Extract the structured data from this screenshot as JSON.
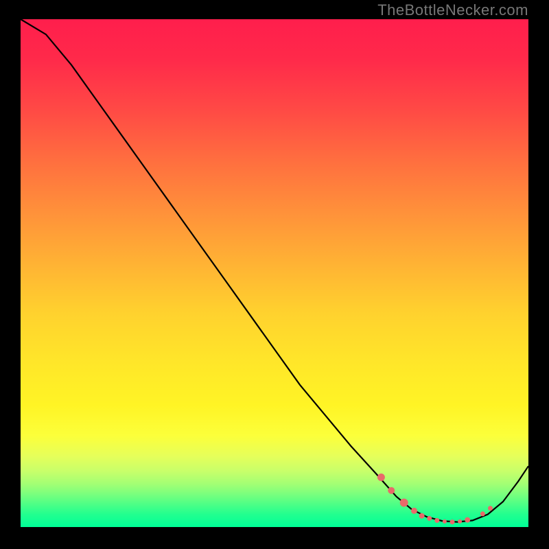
{
  "watermark": "TheBottleNecker.com",
  "chart_data": {
    "type": "line",
    "title": "",
    "xlabel": "",
    "ylabel": "",
    "xlim": [
      0,
      100
    ],
    "ylim": [
      0,
      100
    ],
    "grid": false,
    "legend": false,
    "gradient_stops": [
      {
        "pos": 0,
        "color": "#ff1e4c"
      },
      {
        "pos": 50,
        "color": "#ffd22e"
      },
      {
        "pos": 82,
        "color": "#fcff3a"
      },
      {
        "pos": 100,
        "color": "#00ff97"
      }
    ],
    "series": [
      {
        "name": "curve",
        "color": "#000000",
        "x": [
          0,
          5,
          10,
          15,
          20,
          25,
          30,
          35,
          40,
          45,
          50,
          55,
          60,
          65,
          70,
          74,
          77,
          80,
          83,
          86,
          89,
          92,
          95,
          98,
          100
        ],
        "y": [
          100,
          97,
          91,
          84,
          77,
          70,
          63,
          56,
          49,
          42,
          35,
          28,
          22,
          16,
          10.5,
          6,
          3.5,
          2,
          1.2,
          1,
          1.3,
          2.5,
          5,
          9,
          12
        ]
      }
    ],
    "markers": {
      "color": "#e86a6a",
      "radius_range": [
        2.5,
        6
      ],
      "points": [
        {
          "x": 71,
          "y": 9.8,
          "r": 5.5
        },
        {
          "x": 73,
          "y": 7.2,
          "r": 5
        },
        {
          "x": 75.5,
          "y": 4.8,
          "r": 6
        },
        {
          "x": 77.5,
          "y": 3.2,
          "r": 4.5
        },
        {
          "x": 79,
          "y": 2.2,
          "r": 4
        },
        {
          "x": 80.5,
          "y": 1.7,
          "r": 3.5
        },
        {
          "x": 82,
          "y": 1.3,
          "r": 3.5
        },
        {
          "x": 83.5,
          "y": 1.1,
          "r": 3
        },
        {
          "x": 85,
          "y": 1.0,
          "r": 3.5
        },
        {
          "x": 86.5,
          "y": 1.1,
          "r": 3
        },
        {
          "x": 88,
          "y": 1.4,
          "r": 4
        },
        {
          "x": 91,
          "y": 2.6,
          "r": 3.5
        },
        {
          "x": 92.5,
          "y": 3.7,
          "r": 3.5
        }
      ]
    }
  }
}
